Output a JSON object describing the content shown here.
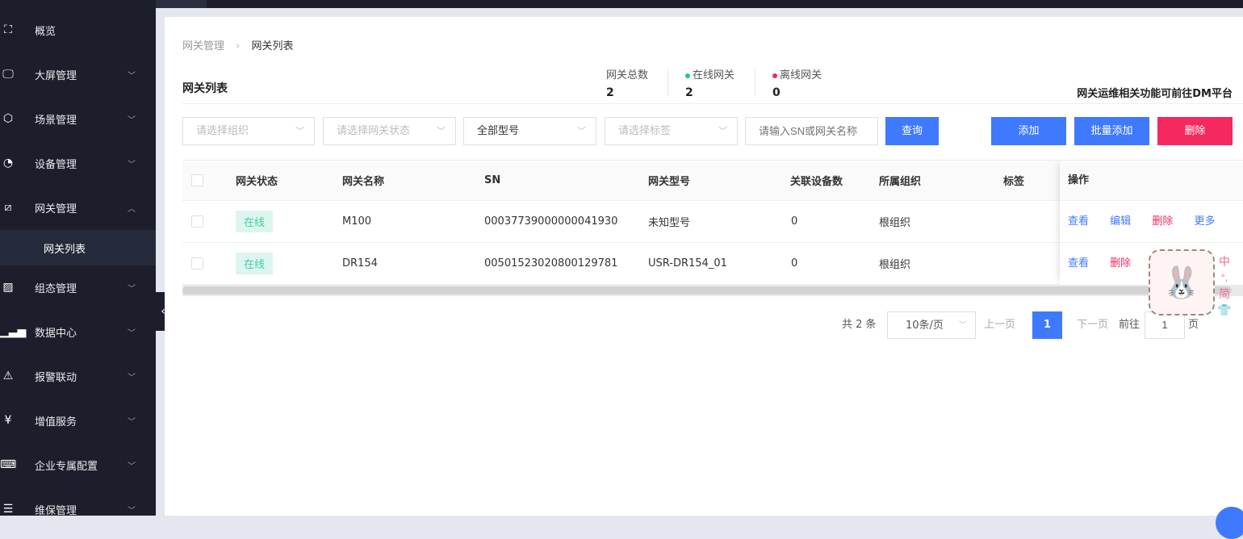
{
  "sidebar": {
    "items": [
      {
        "label": "概览",
        "icon": "overview-icon",
        "glyph": "⛶",
        "chevron": ""
      },
      {
        "label": "大屏管理",
        "icon": "monitor-icon",
        "glyph": "🖵",
        "chevron": "﹀"
      },
      {
        "label": "场景管理",
        "icon": "cube-icon",
        "glyph": "⬡",
        "chevron": "﹀"
      },
      {
        "label": "设备管理",
        "icon": "pie-icon",
        "glyph": "◔",
        "chevron": "﹀"
      },
      {
        "label": "网关管理",
        "icon": "gateway-icon",
        "glyph": "⧄",
        "chevron": "︿"
      },
      {
        "label": "组态管理",
        "icon": "image-icon",
        "glyph": "▨",
        "chevron": "﹀"
      },
      {
        "label": "数据中心",
        "icon": "bar-chart-icon",
        "glyph": "▁▃▅",
        "chevron": "﹀"
      },
      {
        "label": "报警联动",
        "icon": "alarm-icon",
        "glyph": "⚠",
        "chevron": "﹀"
      },
      {
        "label": "增值服务",
        "icon": "yen-icon",
        "glyph": "¥",
        "chevron": "﹀"
      },
      {
        "label": "企业专属配置",
        "icon": "code-monitor-icon",
        "glyph": "⌨",
        "chevron": "﹀"
      },
      {
        "label": "维保管理",
        "icon": "list-icon",
        "glyph": "☰",
        "chevron": "﹀"
      }
    ],
    "sub_item": "网关列表",
    "collapse": "‹"
  },
  "breadcrumb": {
    "parent": "网关管理",
    "sep": "›",
    "current": "网关列表"
  },
  "title": "网关列表",
  "stats": [
    {
      "label": "网关总数",
      "value": "2",
      "dot": ""
    },
    {
      "label": "在线网关",
      "value": "2",
      "dot": "#14c9a0"
    },
    {
      "label": "离线网关",
      "value": "0",
      "dot": "#f5285f"
    }
  ],
  "dm_notice": "网关运维相关功能可前往DM平台",
  "filters": {
    "org": "请选择组织",
    "status": "请选择网关状态",
    "model": "全部型号",
    "tag": "请选择标签",
    "search_placeholder": "请输入SN或网关名称",
    "query": "查询"
  },
  "actions": {
    "add": "添加",
    "batch_add": "批量添加",
    "delete": "删除"
  },
  "colors": {
    "primary": "#3f7afe",
    "danger": "#f5285f",
    "sidebar": "#1c1f2b"
  },
  "table": {
    "headers": [
      "网关状态",
      "网关名称",
      "SN",
      "网关型号",
      "关联设备数",
      "所属组织",
      "标签",
      "操作"
    ],
    "rows": [
      {
        "status": "在线",
        "name": "M100",
        "sn": "00037739000000041930",
        "model": "未知型号",
        "count": "0",
        "org": "根组织",
        "tag": "",
        "ops": [
          "查看",
          "编辑",
          "删除",
          "更多"
        ]
      },
      {
        "status": "在线",
        "name": "DR154",
        "sn": "00501523020800129781",
        "model": "USR-DR154_01",
        "count": "0",
        "org": "根组织",
        "tag": "",
        "ops": [
          "查看",
          "删除"
        ]
      }
    ]
  },
  "pagination": {
    "total": "共 2 条",
    "size": "10条/页",
    "prev": "上一页",
    "page": "1",
    "next": "下一页",
    "goto": "前往",
    "goto_value": "1",
    "page_unit": "页"
  },
  "ime": {
    "lang": "中",
    "punct": "°,",
    "mode": "简"
  }
}
